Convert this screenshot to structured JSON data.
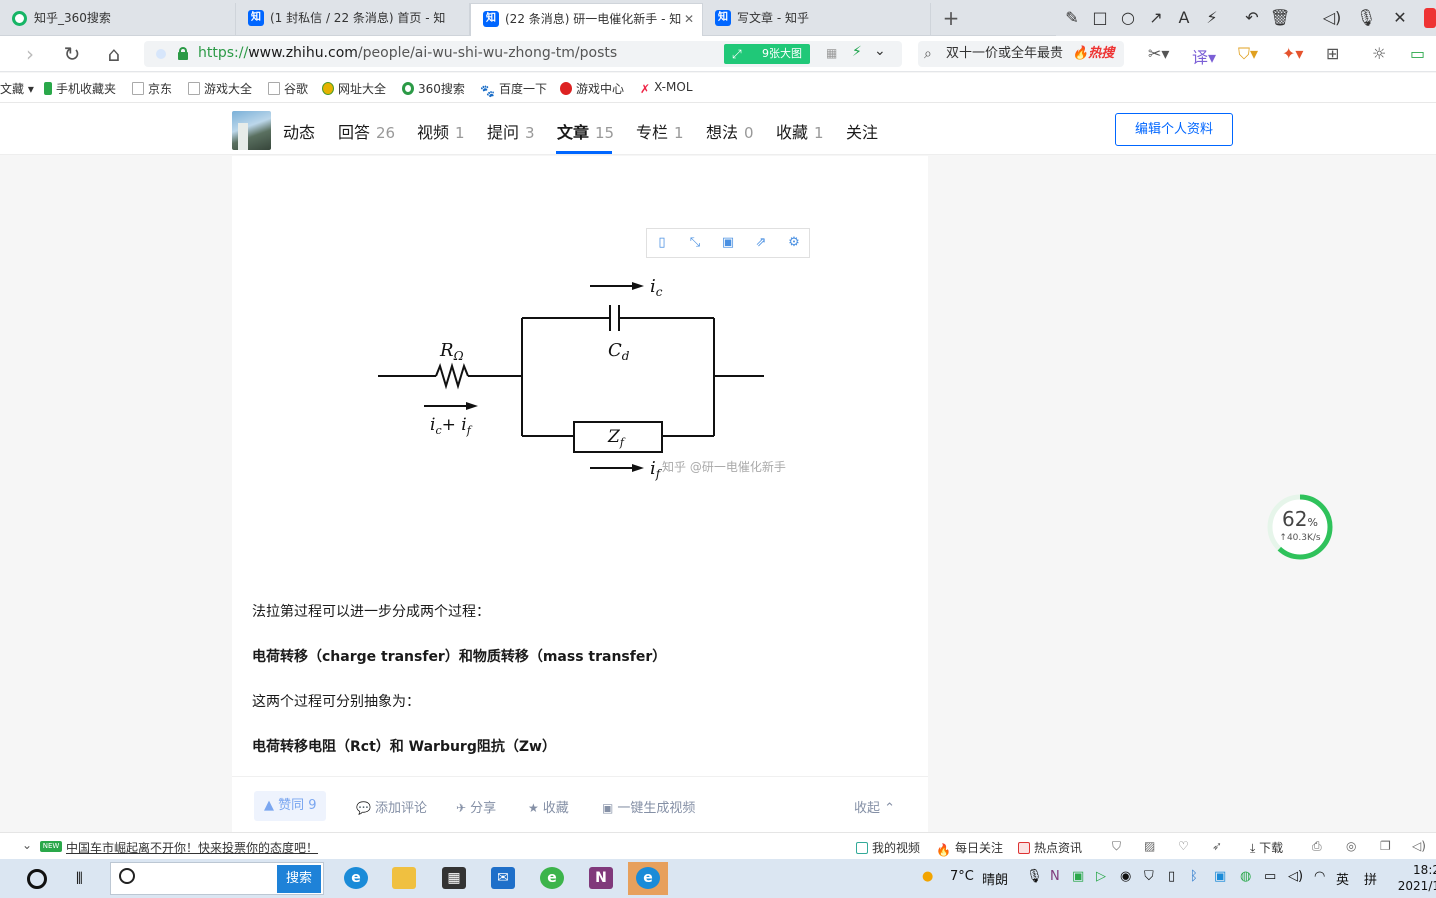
{
  "tabs": [
    {
      "label": "知乎_360搜索",
      "favicon": "360-icon"
    },
    {
      "label": "(1 封私信 / 22 条消息) 首页 - 知",
      "favicon": "zhihu-icon"
    },
    {
      "label": "(22 条消息) 研一电催化新手 - 知",
      "favicon": "zhihu-icon",
      "active": true
    },
    {
      "label": "写文章 - 知乎",
      "favicon": "zhihu-icon"
    }
  ],
  "address": {
    "scheme": "https://",
    "host": "www.zhihu.com",
    "path": "/people/ai-wu-shi-wu-zhong-tm/posts",
    "image_badge": "9张大图"
  },
  "search": {
    "text": "双十一价或全年最贵",
    "hot": "热搜"
  },
  "bookmarks": [
    "文藏",
    "手机收藏夹",
    "京东",
    "游戏大全",
    "谷歌",
    "网址大全",
    "360搜索",
    "百度一下",
    "游戏中心",
    "X-MOL"
  ],
  "profile_nav": {
    "tabs": [
      {
        "label": "动态",
        "count": ""
      },
      {
        "label": "回答",
        "count": "26"
      },
      {
        "label": "视频",
        "count": "1"
      },
      {
        "label": "提问",
        "count": "3"
      },
      {
        "label": "文章",
        "count": "15",
        "active": true
      },
      {
        "label": "专栏",
        "count": "1"
      },
      {
        "label": "想法",
        "count": "0"
      },
      {
        "label": "收藏",
        "count": "1"
      },
      {
        "label": "关注",
        "count": ""
      }
    ],
    "edit_button": "编辑个人资料"
  },
  "article": {
    "circuit_labels": {
      "ic": "i",
      "ic_sub": "c",
      "cd": "C",
      "cd_sub": "d",
      "r": "R",
      "r_sub": "Ω",
      "sum": "i",
      "sum_sub1": "c",
      "sum_plus": "+ i",
      "sum_sub2": "f",
      "zf": "Z",
      "zf_sub": "f",
      "if": "i",
      "if_sub": "f"
    },
    "watermark": "知乎 @研一电催化新手",
    "paragraphs": [
      {
        "text": "法拉第过程可以进一步分成两个过程：",
        "bold": false
      },
      {
        "text": "电荷转移（charge transfer）和物质转移（mass transfer）",
        "bold": true
      },
      {
        "text": "这两个过程可分别抽象为：",
        "bold": false
      },
      {
        "text": "电荷转移电阻（Rct）和 Warburg阻抗（Zw）",
        "bold": true
      }
    ],
    "actions": {
      "vote": "赞同 9",
      "comment": "添加评论",
      "share": "分享",
      "favorite": "收藏",
      "video": "一键生成视频",
      "collapse": "收起"
    }
  },
  "download_ring": {
    "percent": 62,
    "percent_unit": "%",
    "speed": "40.3K/s"
  },
  "statusbar": {
    "news": "中国车市崛起离不开你！快来投票你的态度吧！",
    "new_tag": "NEW",
    "items": [
      "我的视频",
      "每日关注",
      "热点资讯",
      "下载"
    ]
  },
  "taskbar": {
    "search_button": "搜索",
    "weather": "7°C",
    "weather_desc": "晴朗",
    "ime": "英",
    "ime2": "拼",
    "time": "18:2",
    "date": "2021/1"
  }
}
